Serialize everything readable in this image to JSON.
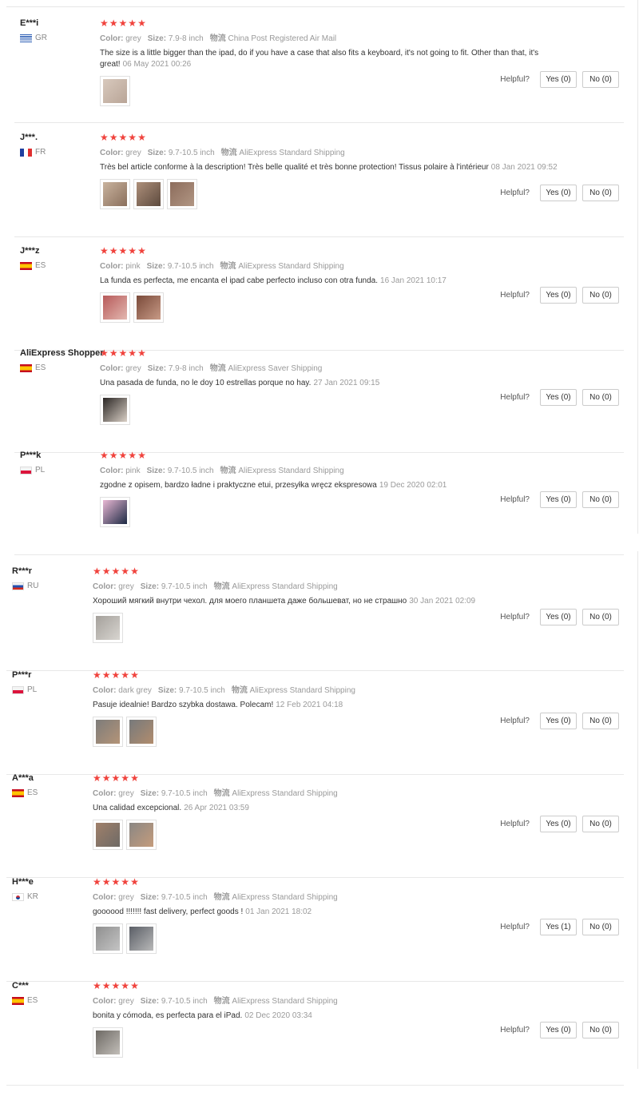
{
  "labels": {
    "color": "Color:",
    "size": "Size:",
    "shipping_icon": "物流",
    "helpful": "Helpful?"
  },
  "star_color": "#f0433d",
  "reviews": [
    {
      "user": "E***i",
      "country": "GR",
      "rating": 5,
      "color": "grey",
      "size": "7.9-8 inch",
      "shipping": "China Post Registered Air Mail",
      "text": "The size is a little bigger than the ipad, do if you have a case that also fits a keyboard, it's not going to fit. Other than that, it's great!",
      "date": "06 May 2021 00:26",
      "photos": 1,
      "yes": "Yes (0)",
      "no": "No (0)"
    },
    {
      "user": "J***.",
      "country": "FR",
      "rating": 5,
      "color": "grey",
      "size": "9.7-10.5 inch",
      "shipping": "AliExpress Standard Shipping",
      "text": "Très bel article conforme à la description! Très belle qualité et très bonne protection! Tissus polaire à l'intérieur",
      "date": "08 Jan 2021 09:52",
      "photos": 3,
      "yes": "Yes (0)",
      "no": "No (0)"
    },
    {
      "user": "J***z",
      "country": "ES",
      "rating": 5,
      "color": "pink",
      "size": "9.7-10.5 inch",
      "shipping": "AliExpress Standard Shipping",
      "text": "La funda es perfecta, me encanta el ipad cabe perfecto incluso con otra funda.",
      "date": "16 Jan 2021 10:17",
      "photos": 2,
      "yes": "Yes (0)",
      "no": "No (0)"
    },
    {
      "user": "AliExpress Shopper",
      "country": "ES",
      "rating": 5,
      "color": "grey",
      "size": "7.9-8 inch",
      "shipping": "AliExpress Saver Shipping",
      "text": "Una pasada de funda, no le doy 10 estrellas porque no hay.",
      "date": "27 Jan 2021 09:15",
      "photos": 1,
      "yes": "Yes (0)",
      "no": "No (0)"
    },
    {
      "user": "P***k",
      "country": "PL",
      "rating": 5,
      "color": "pink",
      "size": "9.7-10.5 inch",
      "shipping": "AliExpress Standard Shipping",
      "text": "zgodne z opisem, bardzo ładne i praktyczne etui, przesyłka wręcz ekspresowa",
      "date": "19 Dec 2020 02:01",
      "photos": 1,
      "yes": "Yes (0)",
      "no": "No (0)"
    },
    {
      "user": "R***r",
      "country": "RU",
      "rating": 5,
      "color": "grey",
      "size": "9.7-10.5 inch",
      "shipping": "AliExpress Standard Shipping",
      "text": "Хороший мягкий внутри чехол. для моего планшета даже большеват, но не страшно",
      "date": "30 Jan 2021 02:09",
      "photos": 1,
      "yes": "Yes (0)",
      "no": "No (0)"
    },
    {
      "user": "P***r",
      "country": "PL",
      "rating": 5,
      "color": "dark grey",
      "size": "9.7-10.5 inch",
      "shipping": "AliExpress Standard Shipping",
      "text": "Pasuje idealnie! Bardzo szybka dostawa. Polecam!",
      "date": "12 Feb 2021 04:18",
      "photos": 2,
      "yes": "Yes (0)",
      "no": "No (0)"
    },
    {
      "user": "A***a",
      "country": "ES",
      "rating": 5,
      "color": "grey",
      "size": "9.7-10.5 inch",
      "shipping": "AliExpress Standard Shipping",
      "text": "Una calidad excepcional.",
      "date": "26 Apr 2021 03:59",
      "photos": 2,
      "yes": "Yes (0)",
      "no": "No (0)"
    },
    {
      "user": "H***e",
      "country": "KR",
      "rating": 5,
      "color": "grey",
      "size": "9.7-10.5 inch",
      "shipping": "AliExpress Standard Shipping",
      "text": "goooood !!!!!!! fast delivery, perfect goods !",
      "date": "01 Jan 2021 18:02",
      "photos": 2,
      "yes": "Yes (1)",
      "no": "No (0)"
    },
    {
      "user": "C***",
      "country": "ES",
      "rating": 5,
      "color": "grey",
      "size": "9.7-10.5 inch",
      "shipping": "AliExpress Standard Shipping",
      "text": "bonita y cómoda, es perfecta para el iPad.",
      "date": "02 Dec 2020 03:34",
      "photos": 1,
      "yes": "Yes (0)",
      "no": "No (0)"
    }
  ]
}
